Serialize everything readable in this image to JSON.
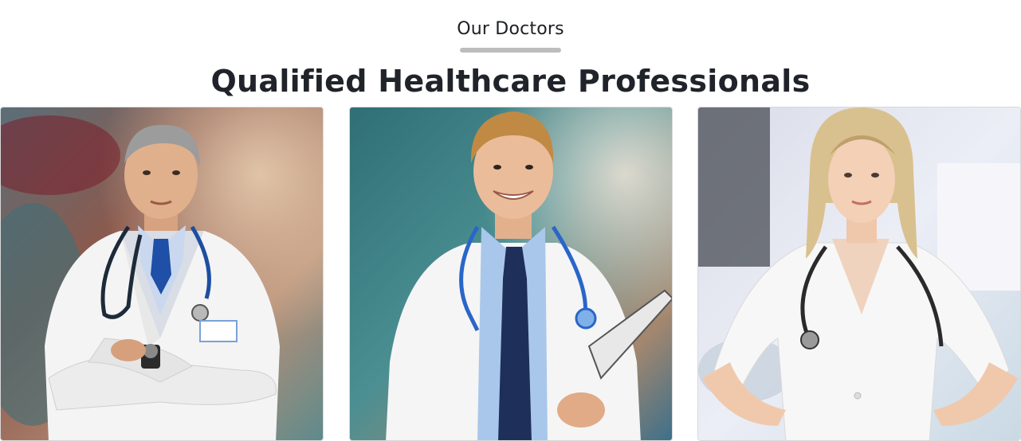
{
  "section": {
    "eyebrow": "Our Doctors",
    "title": "Qualified Healthcare Professionals"
  },
  "colors": {
    "heading_text": "#20232a",
    "underline_bar": "#bdbdbd",
    "card_border": "#d9d9d9"
  },
  "doctors": [
    {
      "photo": "male-doctor-arms-crossed-photo",
      "tie_color": "#1f4fa6"
    },
    {
      "photo": "male-doctor-clipboard-photo",
      "tie_color": "#1e2f5a"
    },
    {
      "photo": "female-doctor-hands-on-hips-photo"
    }
  ]
}
